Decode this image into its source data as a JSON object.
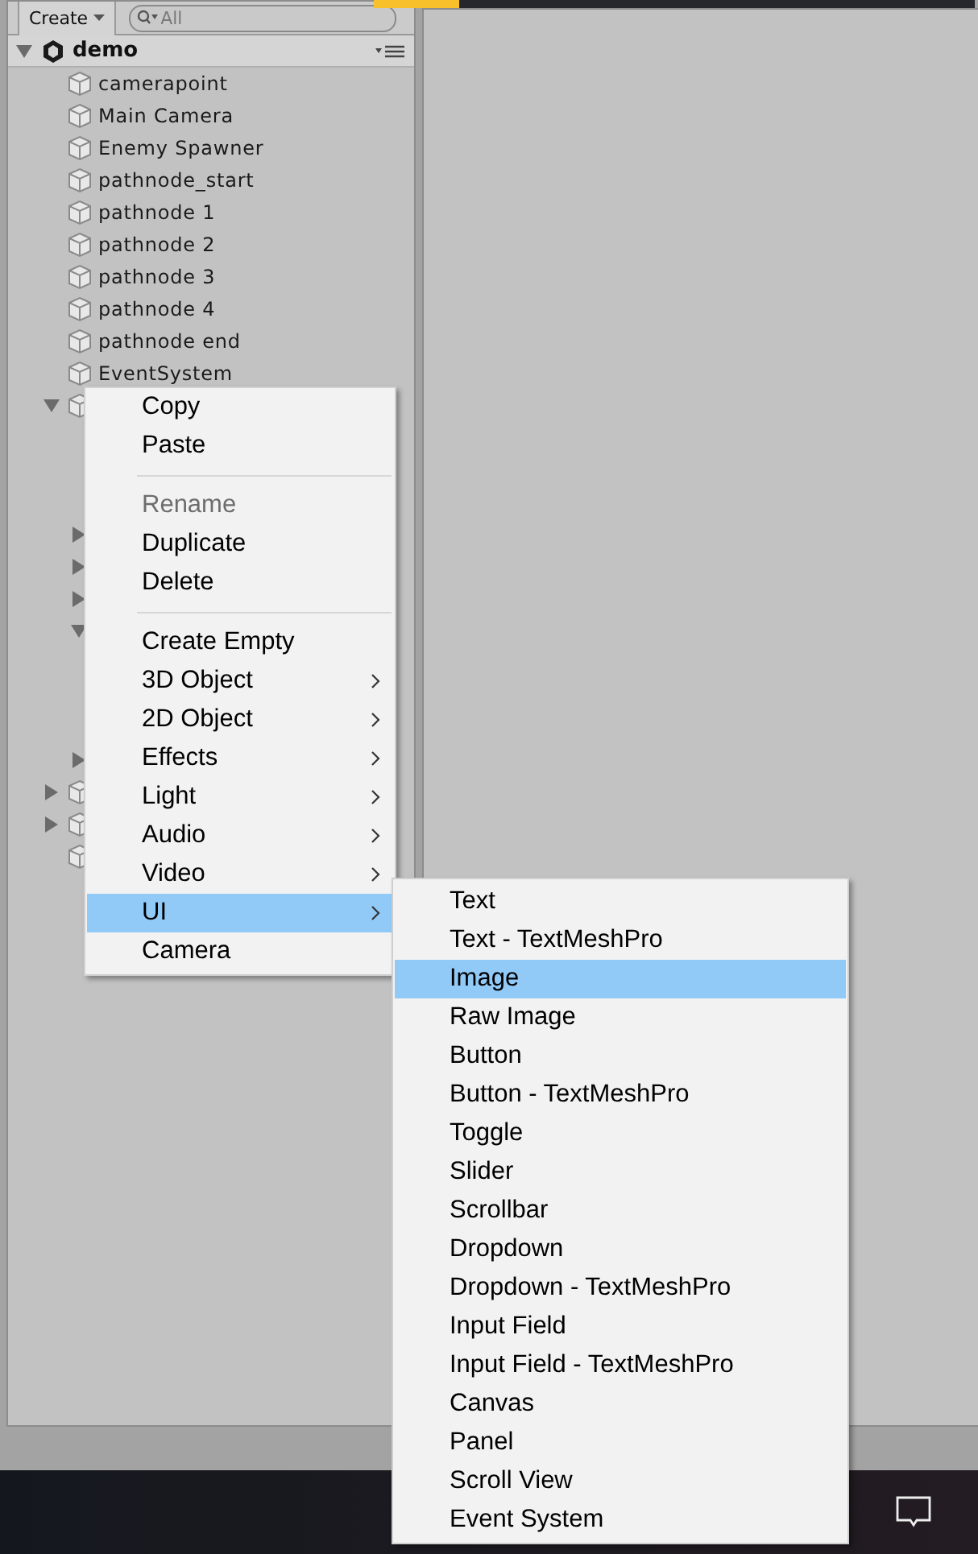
{
  "toolbar": {
    "create_button": "Create",
    "search": {
      "placeholder": "All"
    }
  },
  "scene": {
    "name": "demo",
    "expanded": true
  },
  "tree": [
    {
      "kind": "object",
      "name": "camerapoint"
    },
    {
      "kind": "object",
      "name": "Main Camera"
    },
    {
      "kind": "object",
      "name": "Enemy Spawner"
    },
    {
      "kind": "object",
      "name": "pathnode_start"
    },
    {
      "kind": "object",
      "name": "pathnode 1"
    },
    {
      "kind": "object",
      "name": "pathnode 2"
    },
    {
      "kind": "object",
      "name": "pathnode 3"
    },
    {
      "kind": "object",
      "name": "pathnode 4"
    },
    {
      "kind": "object",
      "name": "pathnode end"
    },
    {
      "kind": "object",
      "name": "EventSystem"
    },
    {
      "kind": "hidden",
      "expanded": true,
      "children": [
        {
          "kind": "hidden"
        },
        {
          "kind": "hidden"
        },
        {
          "kind": "hidden"
        },
        {
          "kind": "hidden",
          "expanded": false
        },
        {
          "kind": "hidden",
          "expanded": false
        },
        {
          "kind": "hidden",
          "expanded": false
        },
        {
          "kind": "hidden",
          "expanded": true,
          "children": [
            {
              "kind": "hidden"
            },
            {
              "kind": "hidden"
            },
            {
              "kind": "hidden"
            }
          ]
        },
        {
          "kind": "hidden",
          "expanded": false
        }
      ]
    },
    {
      "kind": "hidden",
      "expanded": false
    },
    {
      "kind": "hidden",
      "expanded": false
    },
    {
      "kind": "hidden"
    }
  ],
  "context_menu": [
    {
      "kind": "item",
      "label": "Copy",
      "disabled": false,
      "selected": false,
      "has_submenu": false
    },
    {
      "kind": "item",
      "label": "Paste",
      "disabled": false,
      "selected": false,
      "has_submenu": false
    },
    {
      "kind": "separator"
    },
    {
      "kind": "item",
      "label": "Rename",
      "disabled": true,
      "selected": false,
      "has_submenu": false
    },
    {
      "kind": "item",
      "label": "Duplicate",
      "disabled": false,
      "selected": false,
      "has_submenu": false
    },
    {
      "kind": "item",
      "label": "Delete",
      "disabled": false,
      "selected": false,
      "has_submenu": false
    },
    {
      "kind": "separator"
    },
    {
      "kind": "item",
      "label": "Create Empty",
      "disabled": false,
      "selected": false,
      "has_submenu": false
    },
    {
      "kind": "item",
      "label": "3D Object",
      "disabled": false,
      "selected": false,
      "has_submenu": true
    },
    {
      "kind": "item",
      "label": "2D Object",
      "disabled": false,
      "selected": false,
      "has_submenu": true
    },
    {
      "kind": "item",
      "label": "Effects",
      "disabled": false,
      "selected": false,
      "has_submenu": true
    },
    {
      "kind": "item",
      "label": "Light",
      "disabled": false,
      "selected": false,
      "has_submenu": true
    },
    {
      "kind": "item",
      "label": "Audio",
      "disabled": false,
      "selected": false,
      "has_submenu": true
    },
    {
      "kind": "item",
      "label": "Video",
      "disabled": false,
      "selected": false,
      "has_submenu": true
    },
    {
      "kind": "item",
      "label": "UI",
      "disabled": false,
      "selected": true,
      "has_submenu": true
    },
    {
      "kind": "item",
      "label": "Camera",
      "disabled": false,
      "selected": false,
      "has_submenu": false
    }
  ],
  "submenu": [
    {
      "kind": "item",
      "label": "Text",
      "disabled": false,
      "selected": false,
      "has_submenu": false
    },
    {
      "kind": "item",
      "label": "Text - TextMeshPro",
      "disabled": false,
      "selected": false,
      "has_submenu": false
    },
    {
      "kind": "item",
      "label": "Image",
      "disabled": false,
      "selected": true,
      "has_submenu": false
    },
    {
      "kind": "item",
      "label": "Raw Image",
      "disabled": false,
      "selected": false,
      "has_submenu": false
    },
    {
      "kind": "item",
      "label": "Button",
      "disabled": false,
      "selected": false,
      "has_submenu": false
    },
    {
      "kind": "item",
      "label": "Button - TextMeshPro",
      "disabled": false,
      "selected": false,
      "has_submenu": false
    },
    {
      "kind": "item",
      "label": "Toggle",
      "disabled": false,
      "selected": false,
      "has_submenu": false
    },
    {
      "kind": "item",
      "label": "Slider",
      "disabled": false,
      "selected": false,
      "has_submenu": false
    },
    {
      "kind": "item",
      "label": "Scrollbar",
      "disabled": false,
      "selected": false,
      "has_submenu": false
    },
    {
      "kind": "item",
      "label": "Dropdown",
      "disabled": false,
      "selected": false,
      "has_submenu": false
    },
    {
      "kind": "item",
      "label": "Dropdown - TextMeshPro",
      "disabled": false,
      "selected": false,
      "has_submenu": false
    },
    {
      "kind": "item",
      "label": "Input Field",
      "disabled": false,
      "selected": false,
      "has_submenu": false
    },
    {
      "kind": "item",
      "label": "Input Field - TextMeshPro",
      "disabled": false,
      "selected": false,
      "has_submenu": false
    },
    {
      "kind": "item",
      "label": "Canvas",
      "disabled": false,
      "selected": false,
      "has_submenu": false
    },
    {
      "kind": "item",
      "label": "Panel",
      "disabled": false,
      "selected": false,
      "has_submenu": false
    },
    {
      "kind": "item",
      "label": "Scroll View",
      "disabled": false,
      "selected": false,
      "has_submenu": false
    },
    {
      "kind": "item",
      "label": "Event System",
      "disabled": false,
      "selected": false,
      "has_submenu": false
    }
  ]
}
